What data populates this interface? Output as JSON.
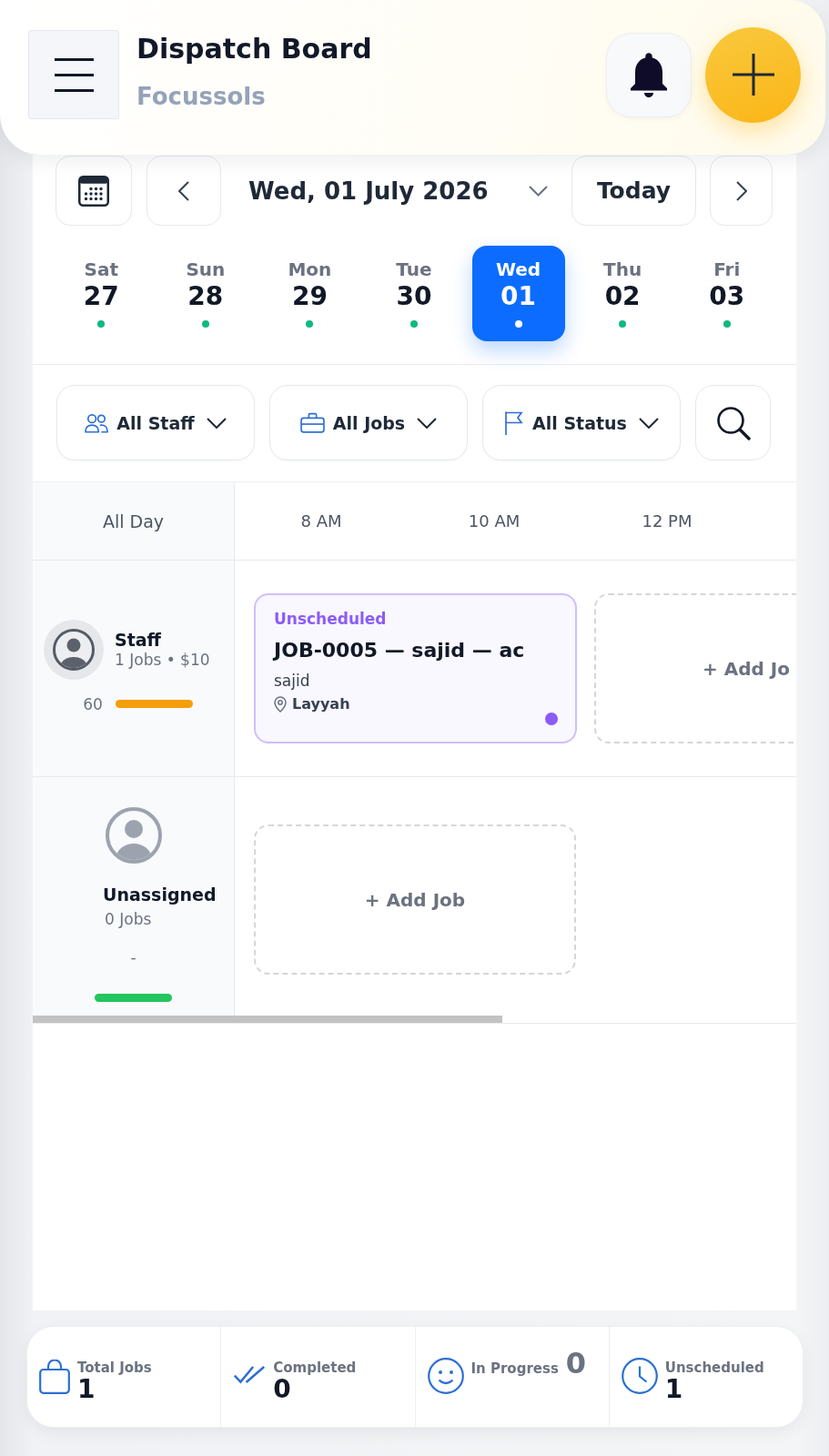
{
  "header": {
    "title": "Dispatch Board",
    "subtitle": "Focussols"
  },
  "date_nav": {
    "date": "Wed, 01 July 2026",
    "today": "Today"
  },
  "days": [
    {
      "name": "Sat",
      "number": "27",
      "selected": false
    },
    {
      "name": "Sun",
      "number": "28",
      "selected": false
    },
    {
      "name": "Mon",
      "number": "29",
      "selected": false
    },
    {
      "name": "Tue",
      "number": "30",
      "selected": false
    },
    {
      "name": "Wed",
      "number": "01",
      "selected": true
    },
    {
      "name": "Thu",
      "number": "02",
      "selected": false
    },
    {
      "name": "Fri",
      "number": "03",
      "selected": false
    }
  ],
  "filters": [
    {
      "label": "All Staff"
    },
    {
      "label": "All Jobs"
    },
    {
      "label": "All Status"
    }
  ],
  "schedule": {
    "all_day_label": "All Day",
    "times": [
      "8 AM",
      "10 AM",
      "12 PM"
    ],
    "rows": [
      {
        "kind": "member",
        "name": "Staff",
        "summary": "1 Jobs • $10",
        "score": "60",
        "color": "#f59e0b",
        "jobs": [
          {
            "status": "Unscheduled",
            "title": "JOB-0005 — sajid — ac",
            "customer": "sajid",
            "location": "Layyah",
            "color": "#8b5cf6"
          }
        ],
        "add_label": "+ Add Jo"
      },
      {
        "kind": "unassigned",
        "name": "Unassigned",
        "summary": "0 Jobs",
        "score": "-",
        "color": "#22c55e",
        "add_label": "+ Add Job"
      }
    ]
  },
  "stats": [
    {
      "label": "Total Jobs",
      "value": "1",
      "kind": "stacked"
    },
    {
      "label": "Completed",
      "value": "0",
      "kind": "stacked"
    },
    {
      "label": "In Progress",
      "value": "0",
      "kind": "inline"
    },
    {
      "label": "Unscheduled",
      "value": "1",
      "kind": "stacked"
    }
  ]
}
